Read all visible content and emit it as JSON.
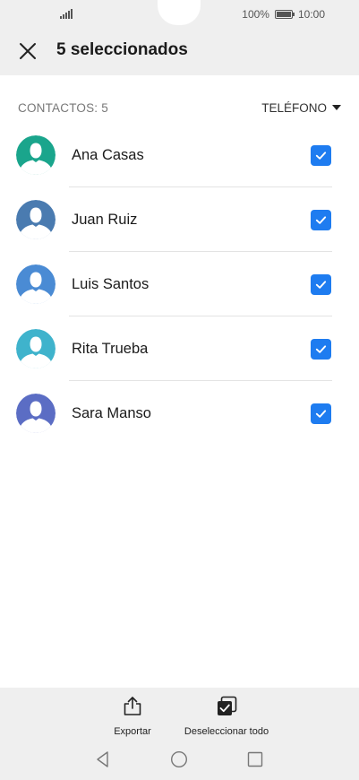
{
  "status_bar": {
    "battery": "100%",
    "time": "10:00"
  },
  "header": {
    "title": "5 seleccionados",
    "close_icon": "close-icon"
  },
  "list_header": {
    "count_label": "CONTACTOS: 5",
    "sort_label": "TELÉFONO"
  },
  "contacts": [
    {
      "name": "Ana Casas",
      "avatar_color": "#1aa58c",
      "checked": true
    },
    {
      "name": "Juan Ruiz",
      "avatar_color": "#4a7bb0",
      "checked": true
    },
    {
      "name": "Luis Santos",
      "avatar_color": "#4a8bd4",
      "checked": true
    },
    {
      "name": "Rita Trueba",
      "avatar_color": "#3fb3cc",
      "checked": true
    },
    {
      "name": "Sara Manso",
      "avatar_color": "#5b6dc4",
      "checked": true
    }
  ],
  "actions": {
    "export_label": "Exportar",
    "deselect_label": "Deseleccionar todo"
  },
  "colors": {
    "accent": "#1e7cf0",
    "bar_background": "#efefef"
  },
  "nav": {
    "back_icon": "back-triangle-icon",
    "home_icon": "home-circle-icon",
    "recents_icon": "recents-square-icon"
  }
}
